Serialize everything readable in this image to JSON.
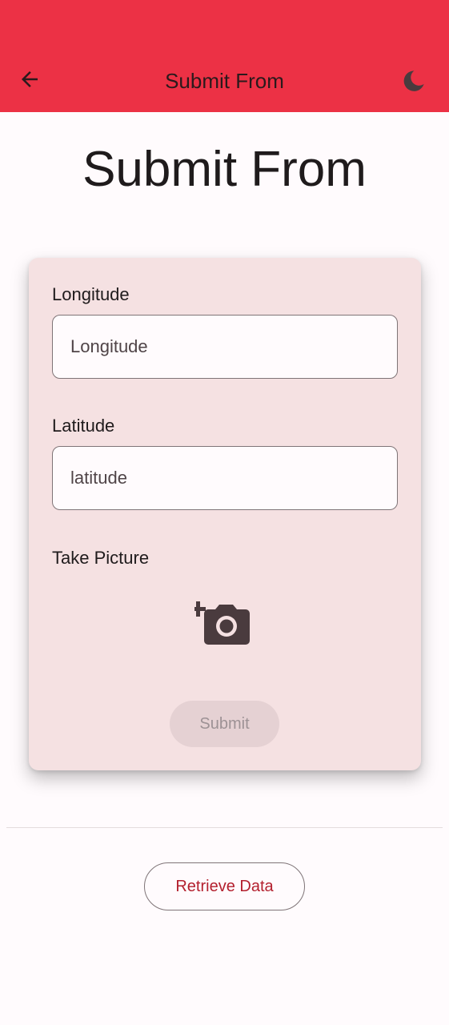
{
  "app_bar": {
    "title": "Submit From",
    "background_color": "#ec3145",
    "back_icon": "arrow-back-icon",
    "theme_icon": "dark-mode-icon"
  },
  "page": {
    "title": "Submit From"
  },
  "form": {
    "longitude": {
      "label": "Longitude",
      "placeholder": "Longitude",
      "value": ""
    },
    "latitude": {
      "label": "Latitude",
      "placeholder": "latitude",
      "value": ""
    },
    "picture": {
      "label": "Take Picture",
      "icon": "add-a-photo-icon"
    },
    "submit_label": "Submit",
    "submit_enabled": false
  },
  "retrieve_label": "Retrieve Data",
  "colors": {
    "card_background": "#f5e1e2",
    "retrieve_text": "#b3202e"
  }
}
